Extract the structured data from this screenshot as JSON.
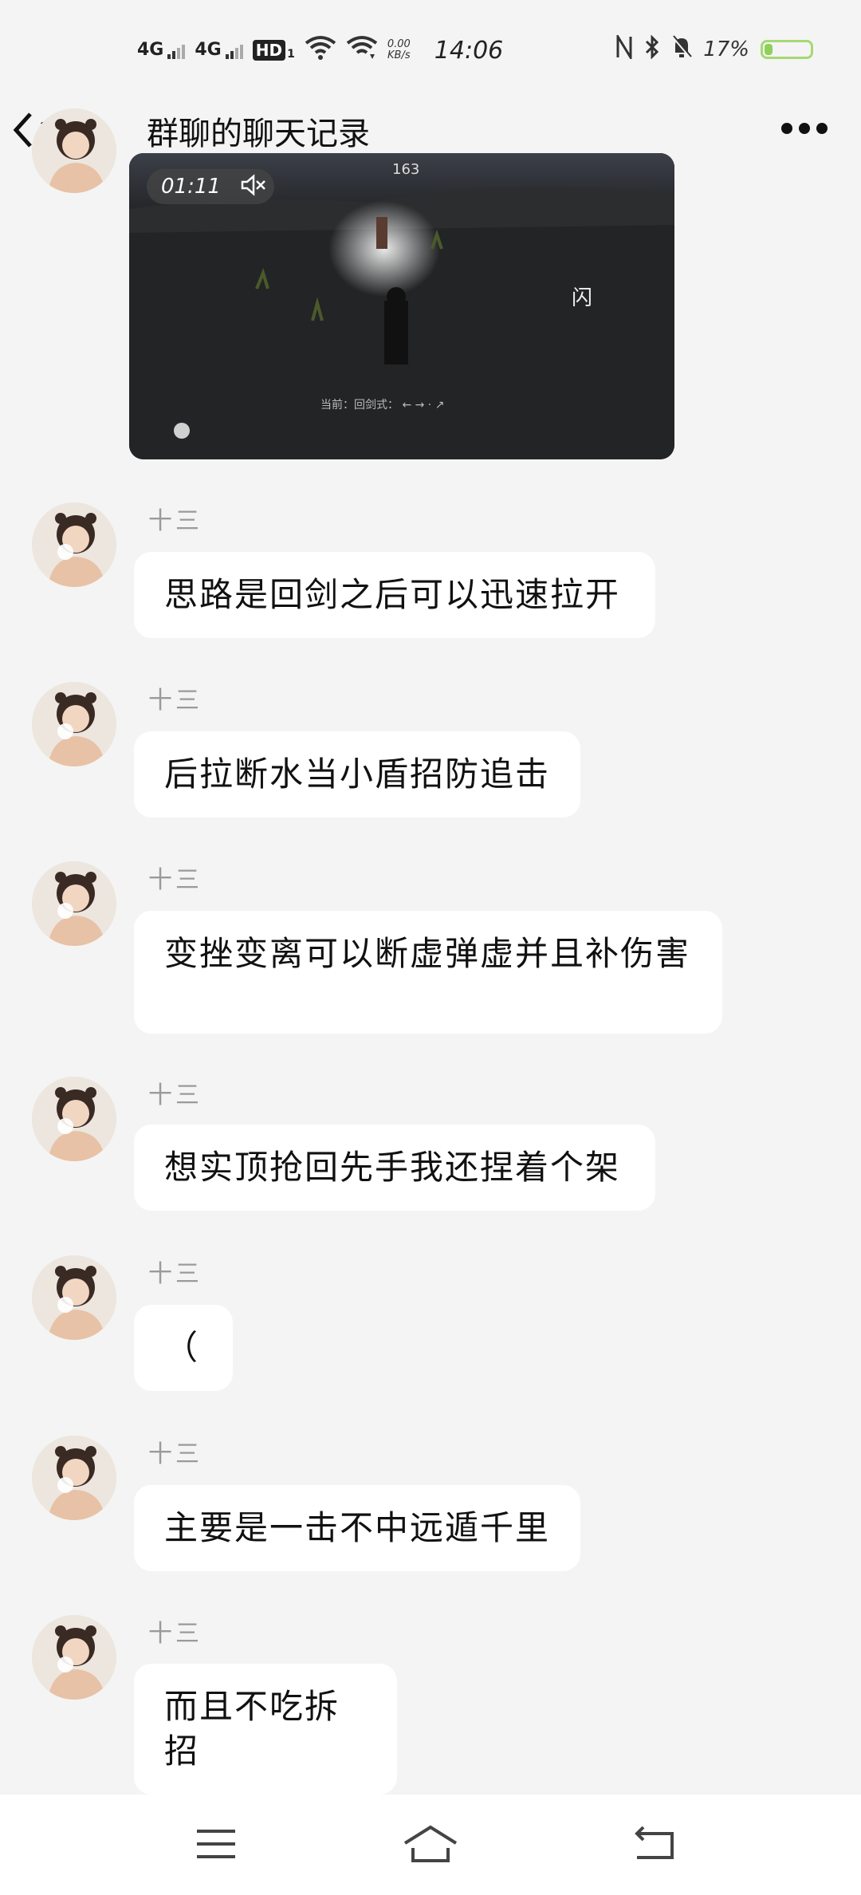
{
  "status_bar": {
    "signal1": "4G",
    "signal2": "4G",
    "hd": "HD",
    "hd_sub": "1",
    "net_speed_value": "0.00",
    "net_speed_unit": "KB/s",
    "time": "14:06",
    "battery": "17%",
    "battery_level": 0.17,
    "battery_color": "#8fd05a"
  },
  "header": {
    "back_label": "返回",
    "title": "群聊的聊天记录"
  },
  "video": {
    "duration": "01:11",
    "hud_number": "163"
  },
  "messages": [
    {
      "sender": "十三",
      "text": "思路是回剑之后可以迅速拉开"
    },
    {
      "sender": "十三",
      "text": "后拉断水当小盾招防追击"
    },
    {
      "sender": "十三",
      "text": "变挫变离可以断虚弹虚并且补伤害"
    },
    {
      "sender": "十三",
      "text": "想实顶抢回先手我还捏着个架"
    },
    {
      "sender": "十三",
      "text": "（"
    },
    {
      "sender": "十三",
      "text": "主要是一击不中远遁千里"
    },
    {
      "sender": "十三",
      "text": "而且不吃拆招"
    }
  ],
  "nav": {
    "menu_icon": "menu-icon",
    "home_icon": "home-icon",
    "back_icon": "back-icon"
  }
}
